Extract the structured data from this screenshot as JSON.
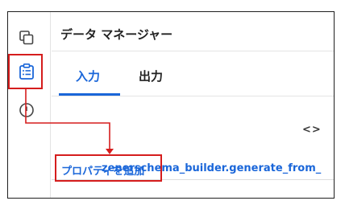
{
  "panel": {
    "title": "データ マネージャー"
  },
  "tabs": [
    {
      "label": "入力",
      "active": true
    },
    {
      "label": "出力",
      "active": false
    }
  ],
  "code_toggle": "<>",
  "content": {
    "add_property_label": "プロパティを追加",
    "overlapping_text": "zenerschema_builder.generate_from_"
  },
  "rail": {
    "icons": [
      "copy-icon",
      "clipboard-list-icon",
      "circle-icon"
    ]
  },
  "colors": {
    "accent": "#1a66d9",
    "highlight": "#d51d1d",
    "text": "#222222",
    "divider": "#e4e4e4"
  }
}
